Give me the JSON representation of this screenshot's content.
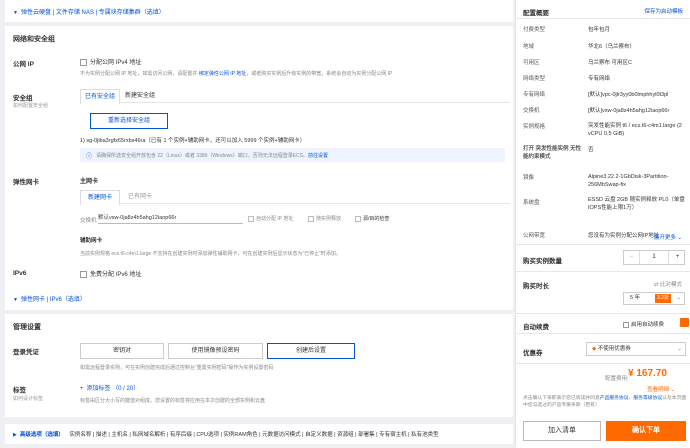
{
  "top_bar": {
    "text": "弹性云硬盘 | 文件存储 NAS | 专属块存储集群（选填）"
  },
  "network": {
    "title": "网络和安全组",
    "public_ip": {
      "label": "公网 IP",
      "checkbox": "分配公网 IPv4 地址",
      "hint_pre": "不为实例分配公网 IP 地址，如需访问公网，请配置并 ",
      "hint_link": "绑定弹性公网 IP 地址",
      "hint_post": "，或者购买实例后升级实例的带宽。系统会自动为实例分配公网 IP"
    },
    "security_group": {
      "label": "安全组",
      "sublabel": "如何配置安全组",
      "tab_existing": "已有安全组",
      "tab_new": "新建安全组",
      "reselect_button": "重新选择安全组",
      "selected": "1) sg-0jiba3rgfx65rxbx46ra（已有 1 个实例+辅助网卡，还可以加入 5999 个实例+辅助网卡）",
      "info_pre": "请确保所选安全组开放包含 22（Linux）或者 3389（Windows）端口，否则无法远程登录ECS。",
      "info_link": "前往设置"
    },
    "eni": {
      "label": "弹性网卡",
      "primary_title": "主网卡",
      "tab_new": "新建网卡",
      "tab_existing": "已有网卡",
      "vsw_label": "交换机",
      "vsw_value": "默认vsw-0ja8z4h5ahg12iaop66r",
      "opt_auto_ip": "自动分配 IP 地址",
      "opt_release": "随实例释放",
      "opt_check": "源/目的检查",
      "aux_title": "辅助网卡",
      "aux_hint": "当前实例规格 ecs.t6-c4m1.large 不支持在创建实例时添加弹性辅助网卡，可在创建实例后显示状态为“已停止”时添加。"
    },
    "ipv6": {
      "label": "IPv6",
      "checkbox": "免费分配 IPv6 地址"
    }
  },
  "eni_collapse": {
    "text": "弹性网卡 | IPv6（选填）"
  },
  "management": {
    "title": "管理设置",
    "login": {
      "label": "登录凭证",
      "opt_keypair": "密钥对",
      "opt_image": "使用镜像预设密码",
      "opt_later": "创建后设置",
      "hint_pre": "如需远程登录实例，可在实例创建完成后通过控制台“重置实例密码”操作为实例设置密码",
      "hint_link": "",
      "hint_post": ""
    },
    "tags": {
      "label": "标签",
      "sublabel": "如何设计标签",
      "add": "添加标签 （0 / 20）",
      "hint": "标签由区分大小写的键值对组成。您设置的标签将应用在本次创建的全部实例和云盘"
    }
  },
  "advanced": {
    "label": "高级选项（选填）",
    "items": "实例名称 | 描述 | 主机名 | 私网域名解析 | 有序后缀 | CPU选项 | 实例RAM角色 | 元数据访问模式 | 自定义数据 | 资源组 | 部署集 | 专有宿主机 | 私有池类型"
  },
  "summary": {
    "title": "配置概要",
    "save_link": "保存为启动模板",
    "specs": [
      {
        "k": "付费类型",
        "v": "包年包月"
      },
      {
        "k": "地域",
        "v": "华北6（乌兰察布）"
      },
      {
        "k": "可用区",
        "v": "乌兰察布 可用区C"
      },
      {
        "k": "网络类型",
        "v": "专有网络"
      },
      {
        "k": "专有网络",
        "v": "[默认]vpc-0jlr3yy0b0lmphhyl0t3pl"
      },
      {
        "k": "交换机",
        "v": "[默认]vsw-0ja8z4h5ahg12iaop66r"
      },
      {
        "k": "实例规格",
        "v": "突发性能实例 t6 / ecs.t6-c4m1.large (2 vCPU 0.5 GiB)"
      },
      {
        "k": "打开 突发性能实例 无性能约束模式",
        "v": "否"
      },
      {
        "k": "镜像",
        "v": "Alpine3.22.2-1GbDisk-3Partition-256MbSwap-fix"
      },
      {
        "k": "系统盘",
        "v": "ESSD 云盘 2GB 随实例释放 PL0（单盘IOPS性能上限1万）"
      },
      {
        "k": "公网带宽",
        "v": "您没有为实例分配公网IP地址"
      }
    ],
    "view_more": "展开更多",
    "qty_label": "购买实例数量",
    "qty_value": "1",
    "qty_minus": "−",
    "qty_plus": "+",
    "duration_label": "购买时长",
    "compare": "比对模式",
    "duration_value": "5 年",
    "discount": "3.2折",
    "renew_label": "自动续费",
    "renew_checkbox": "启用自动续费",
    "coupon_label": "优惠券",
    "coupon_value": "不使用优惠券",
    "price_label": "配置费用:",
    "price": "¥ 167.70",
    "price_link": "查看明细",
    "agree_pre": "点击确认下单即表示您已阅读并同意",
    "agree_link1": "产品服务协议",
    "agree_mid": "、",
    "agree_link2": "服务等级协议",
    "agree_post": "以及本页面中您勾选过的产品专属条款（若有）",
    "add_cart": "加入清单",
    "confirm": "确认下单"
  },
  "colors": {
    "accent": "#0052d9",
    "orange": "#ff6a00"
  }
}
